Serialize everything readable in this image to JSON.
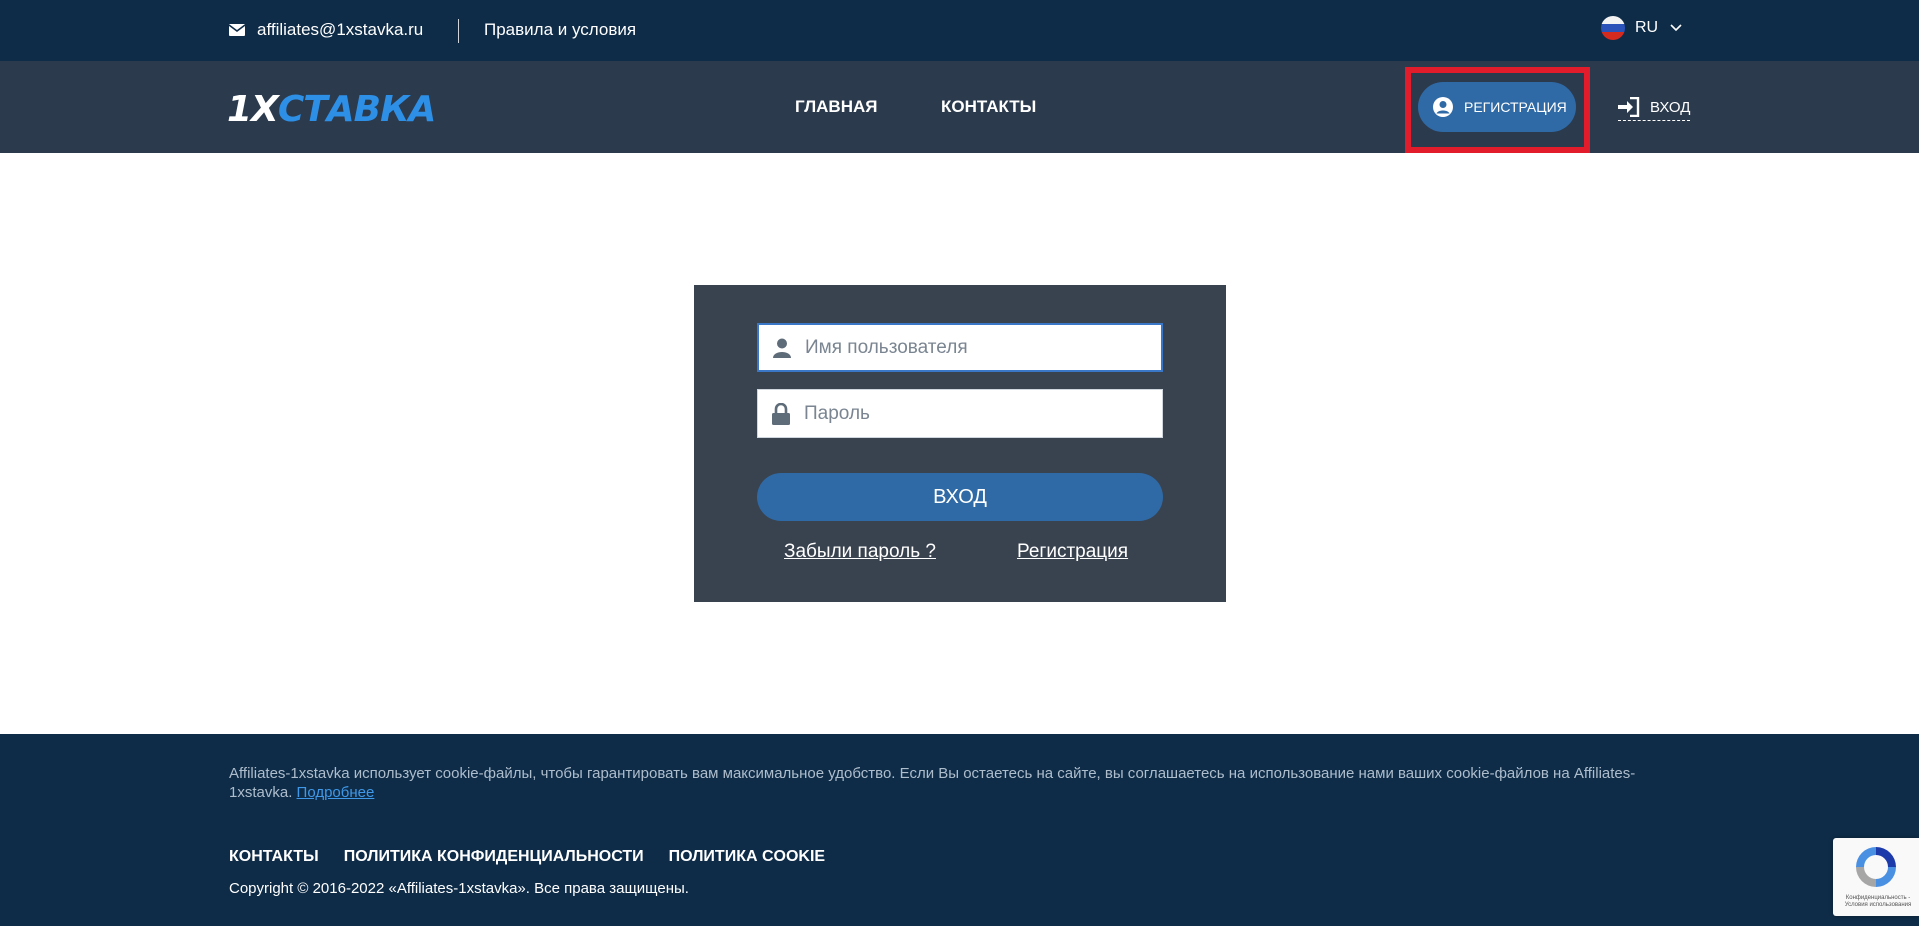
{
  "topbar": {
    "email": "affiliates@1xstavka.ru",
    "rules_link": "Правила и условия",
    "language": "RU"
  },
  "navbar": {
    "logo_part1": "1X",
    "logo_part2": "СТАВКА",
    "nav": [
      {
        "label": "ГЛАВНАЯ"
      },
      {
        "label": "КОНТАКТЫ"
      }
    ],
    "register_label": "РЕГИСТРАЦИЯ",
    "login_label": "ВХОД"
  },
  "login_form": {
    "username_placeholder": "Имя пользователя",
    "password_placeholder": "Пароль",
    "submit_label": "ВХОД",
    "forgot_link": "Забыли пароль ?",
    "register_link": "Регистрация"
  },
  "footer": {
    "cookie_text": "Affiliates-1xstavka использует cookie-файлы, чтобы гарантировать вам максимальное удобство. Если Вы остаетесь на сайте, вы соглашаетесь на использование нами ваших cookie-файлов на Affiliates-1xstavka.",
    "cookie_more": "Подробнее",
    "links": [
      {
        "label": "КОНТАКТЫ"
      },
      {
        "label": "ПОЛИТИКА КОНФИДЕНЦИАЛЬНОСТИ"
      },
      {
        "label": "ПОЛИТИКА COOKIE"
      }
    ],
    "copyright": "Copyright © 2016-2022 «Affiliates-1xstavka». Все права защищены."
  },
  "recaptcha": {
    "text": "Конфиденциальность - Условия использования"
  },
  "colors": {
    "topbar_bg": "#0e2c48",
    "navbar_bg": "#2b3a4d",
    "accent_blue": "#2f6aa6",
    "highlight_red": "#e31c2b",
    "login_box_bg": "#39424f"
  },
  "icons": [
    "envelope-icon",
    "russia-flag-icon",
    "chevron-down-icon",
    "user-circle-icon",
    "sign-in-icon",
    "user-icon",
    "lock-icon",
    "recaptcha-icon"
  ]
}
